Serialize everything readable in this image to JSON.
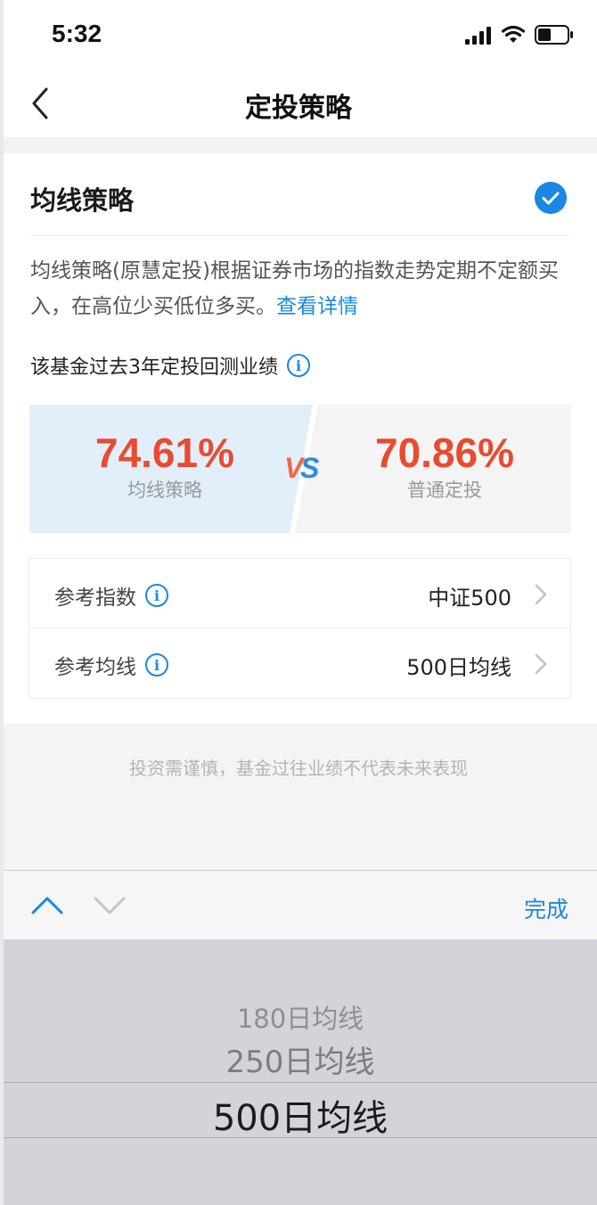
{
  "status_bar": {
    "time": "5:32"
  },
  "nav": {
    "title": "定投策略"
  },
  "strategy": {
    "title": "均线策略",
    "description": "均线策略(原慧定投)根据证券市场的指数走势定期不定额买入，在高位少买低位多买。",
    "link": "查看详情",
    "backtest_label": "该基金过去3年定投回测业绩",
    "info_glyph": "i"
  },
  "comparison": {
    "left": {
      "value": "74.61%",
      "label": "均线策略"
    },
    "vs": "VS",
    "right": {
      "value": "70.86%",
      "label": "普通定投"
    }
  },
  "references": [
    {
      "label": "参考指数",
      "value": "中证500"
    },
    {
      "label": "参考均线",
      "value": "500日均线"
    }
  ],
  "disclaimer": "投资需谨慎，基金过往业绩不代表未来表现",
  "toolbar": {
    "done_label": "完成"
  },
  "picker": {
    "options": [
      "180日均线",
      "250日均线",
      "500日均线"
    ],
    "selected": "500日均线"
  },
  "colors": {
    "accent": "#1a88e2",
    "value_red": "#e84b2f",
    "compare_left_bg": "#e2effb",
    "picker_bg": "#d2d4d9"
  }
}
